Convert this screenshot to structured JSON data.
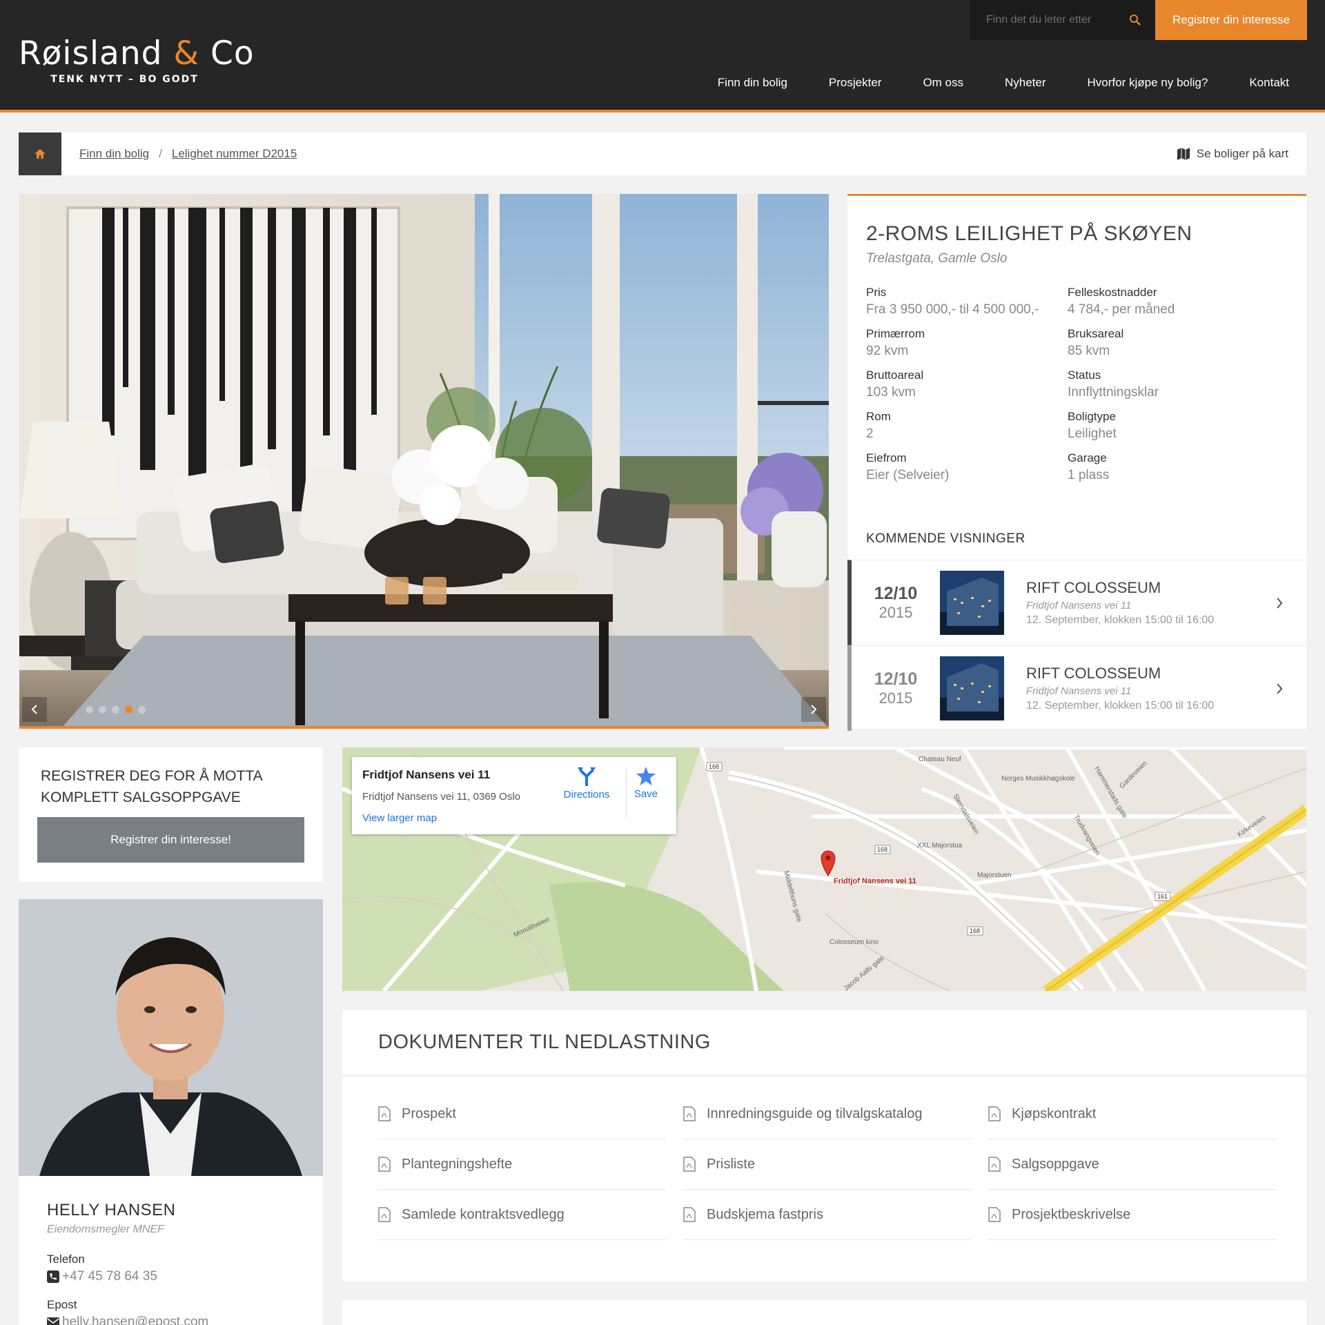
{
  "header": {
    "logo_main": "Røisland",
    "logo_amp": "&",
    "logo_end": "Co",
    "tagline": "TENK NYTT – BO GODT",
    "search_placeholder": "Finn det du leter etter",
    "register_label": "Registrer din interesse",
    "nav": [
      "Finn din bolig",
      "Prosjekter",
      "Om oss",
      "Nyheter",
      "Hvorfor kjøpe ny bolig?",
      "Kontakt"
    ],
    "accent_color": "#e8872c"
  },
  "breadcrumb": {
    "items": [
      "Finn din bolig",
      "Lelighet nummer D2015"
    ],
    "separator": "/",
    "map_link": "Se boliger på kart"
  },
  "gallery": {
    "slide_count": 5,
    "active_slide": 4
  },
  "property": {
    "title": "2-ROMS LEILIGHET PÅ SKØYEN",
    "address": "Trelastgata, Gamle Oslo",
    "facts": [
      {
        "label": "Pris",
        "value": "Fra 3 950 000,- til 4 500 000,-"
      },
      {
        "label": "Felleskostnadder",
        "value": "4 784,- per måned"
      },
      {
        "label": "Primærrom",
        "value": "92 kvm"
      },
      {
        "label": "Bruksareal",
        "value": "85 kvm"
      },
      {
        "label": "Bruttoareal",
        "value": "103 kvm"
      },
      {
        "label": "Status",
        "value": "Innflyttningsklar"
      },
      {
        "label": "Rom",
        "value": "2"
      },
      {
        "label": "Boligtype",
        "value": "Leilighet"
      },
      {
        "label": "Eiefrom",
        "value": "Eier (Selveier)"
      },
      {
        "label": "Garage",
        "value": "1 plass"
      }
    ],
    "upcoming_heading": "KOMMENDE VISNINGER",
    "viewings": [
      {
        "day": "12/10",
        "year": "2015",
        "title": "RIFT COLOSSEUM",
        "address": "Fridtjof Nansens vei 11",
        "time": "12. September,  klokken 15:00 til 16:00"
      },
      {
        "day": "12/10",
        "year": "2015",
        "title": "RIFT COLOSSEUM",
        "address": "Fridtjof Nansens vei 11",
        "time": "12. September,  klokken 15:00 til 16:00"
      }
    ]
  },
  "register": {
    "title": "REGISTRER DEG FOR Å MOTTA KOMPLETT SALGSOPPGAVE",
    "button": "Registrer din interesse!"
  },
  "agent": {
    "name": "HELLY HANSEN",
    "role": "Eiendomsmegler MNEF",
    "phone_label": "Telefon",
    "phone": "+47 45 78 64 35",
    "email_label": "Epost",
    "email": "helly.hansen@epost.com"
  },
  "map": {
    "card_title": "Fridtjof Nansens vei 11",
    "card_address": "Fridtjof Nansens vei 11, 0369 Oslo",
    "larger_map": "View larger map",
    "directions": "Directions",
    "save": "Save",
    "pin_label": "Fridtjof Nansens vei 11",
    "labels": [
      "Chateau Neuf",
      "Norges Musikkhøgskole",
      "XXL Majorstua",
      "Majorstuen",
      "Colosseum kino",
      "Monolitveien",
      "Middelthuns gate",
      "Slemdalsveien",
      "Kirkeveien",
      "Hammerstads gate",
      "Trudvangveien",
      "Gardeveien",
      "Jacob Aalls gate"
    ],
    "road_numbers": [
      "168",
      "168",
      "168",
      "161"
    ]
  },
  "documents": {
    "heading": "DOKUMENTER TIL NEDLASTNING",
    "items": [
      "Prospekt",
      "Innredningsguide og tilvalgskatalog",
      "Kjøpskontrakt",
      "Plantegningshefte",
      "Prisliste",
      "Salgsoppgave",
      "Samlede kontraktsvedlegg",
      "Budskjema fastpris",
      "Prosjektbeskrivelse"
    ]
  }
}
